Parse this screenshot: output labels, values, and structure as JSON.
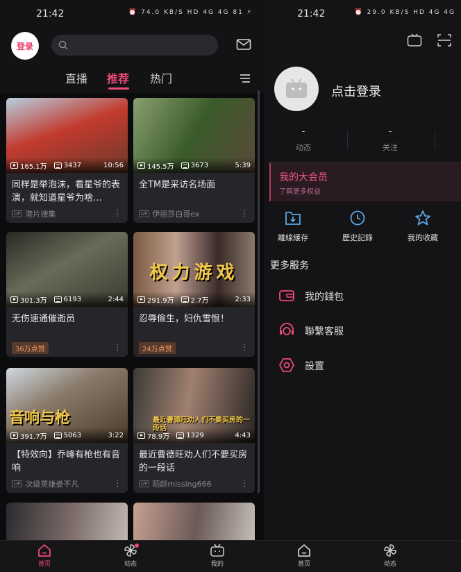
{
  "colors": {
    "accent": "#f04a77",
    "background": "#131316",
    "card": "#26262a"
  },
  "left_status": {
    "time": "21:42",
    "icons": "⏰ 74.0 KB/S HD 4G 4G 81 ⚡"
  },
  "right_status": {
    "time": "21:42",
    "icons": "⏰ 29.0 KB/S HD 4G 4G"
  },
  "header": {
    "login_label": "登录",
    "search_placeholder": "",
    "mail_icon": "mail-icon"
  },
  "tabs": [
    {
      "label": "直播",
      "active": false
    },
    {
      "label": "推荐",
      "active": true
    },
    {
      "label": "热门",
      "active": false
    }
  ],
  "feed": [
    {
      "views": "165.1万",
      "danmaku": "3437",
      "duration": "10:56",
      "title": "同样是举泡沫，看星爷的表演，就知道星爷为啥…",
      "author": "港片搜集",
      "likes": "",
      "thumb_color": "#8a3a2e"
    },
    {
      "views": "145.5万",
      "danmaku": "3673",
      "duration": "5:39",
      "title": "全TM是采访名场面",
      "author": "伊丽莎白哥ex",
      "likes": "",
      "thumb_color": "#4a5a3a"
    },
    {
      "views": "301.3万",
      "danmaku": "6193",
      "duration": "2:44",
      "title": "无伤速通催逝员",
      "author": "",
      "likes": "36万点赞",
      "thumb_color": "#55574a"
    },
    {
      "views": "291.9万",
      "danmaku": "2.7万",
      "duration": "2:33",
      "title": "忍辱偷生，妇仇雪恨！",
      "author": "",
      "likes": "24万点赞",
      "thumb_color": "#6a4a3a",
      "overlay": "权力游戏"
    },
    {
      "views": "391.7万",
      "danmaku": "5063",
      "duration": "3:22",
      "title": "【特效向】乔峰有枪也有音响",
      "author": "次级英雄娄不凡",
      "likes": "",
      "thumb_color": "#6a5a4a",
      "overlay": "音响与枪"
    },
    {
      "views": "78.9万",
      "danmaku": "1329",
      "duration": "4:43",
      "title": "最近曹德旺劝人们不要买房的一段话",
      "author": "陌颜missing666",
      "likes": "",
      "thumb_color": "#5a4a40",
      "overlay": "最近曹德旺劝人们不要买房的一段话"
    },
    {
      "views": "",
      "danmaku": "",
      "duration": "",
      "title": "",
      "author": "",
      "likes": "",
      "thumb_color": "#4a4448"
    },
    {
      "views": "",
      "danmaku": "",
      "duration": "",
      "title": "",
      "author": "",
      "likes": "",
      "thumb_color": "#5a5050"
    }
  ],
  "bottom_nav": [
    {
      "label": "首页",
      "icon": "home-icon",
      "active": true
    },
    {
      "label": "动态",
      "icon": "pinwheel-icon",
      "active": false
    },
    {
      "label": "我的",
      "icon": "tv-icon",
      "active": false
    },
    {
      "label": "首页",
      "icon": "home-icon",
      "active": false
    },
    {
      "label": "动态",
      "icon": "pinwheel-icon",
      "active": false
    }
  ],
  "profile": {
    "login_text": "点击登录",
    "stats": [
      {
        "value": "-",
        "label": "动态"
      },
      {
        "value": "-",
        "label": "关注"
      }
    ],
    "vip_title": "我的大会员",
    "vip_subtitle": "了解更多权益",
    "quick_actions": [
      {
        "label": "離線緩存",
        "icon": "download-icon"
      },
      {
        "label": "歷史記錄",
        "icon": "history-icon"
      },
      {
        "label": "我的收藏",
        "icon": "star-icon"
      }
    ],
    "more_services_title": "更多服务",
    "services": [
      {
        "label": "我的錢包",
        "icon": "wallet-icon"
      },
      {
        "label": "聯繫客服",
        "icon": "headset-icon"
      },
      {
        "label": "設置",
        "icon": "gear-icon"
      }
    ]
  }
}
